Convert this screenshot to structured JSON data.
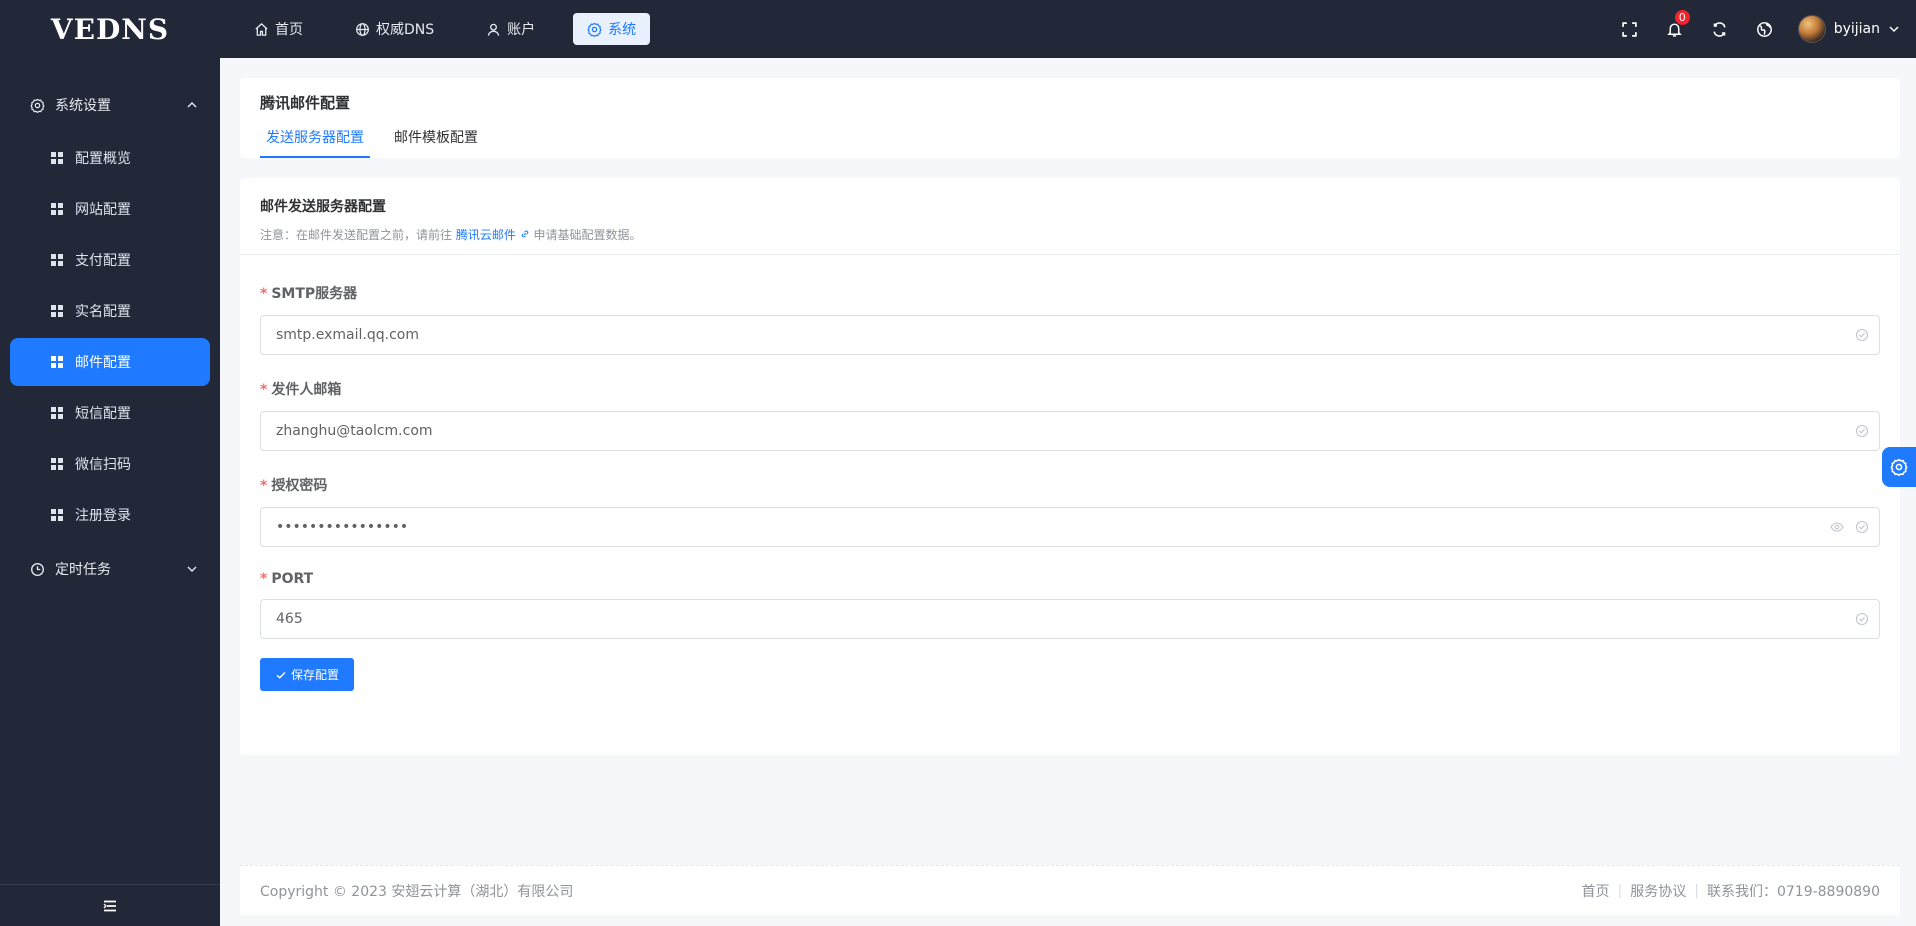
{
  "app": {
    "logo": "VEDNS"
  },
  "topnav": [
    {
      "label": "首页",
      "icon": "home-icon"
    },
    {
      "label": "权威DNS",
      "icon": "globe-icon"
    },
    {
      "label": "账户",
      "icon": "user-icon"
    },
    {
      "label": "系统",
      "icon": "gear-icon",
      "active": true
    }
  ],
  "header": {
    "notification_count": "0",
    "username": "byijian"
  },
  "sidebar": {
    "group1": "系统设置",
    "items": [
      "配置概览",
      "网站配置",
      "支付配置",
      "实名配置",
      "邮件配置",
      "短信配置",
      "微信扫码",
      "注册登录"
    ],
    "active_item": "邮件配置",
    "group2": "定时任务"
  },
  "page": {
    "card_title": "腾讯邮件配置",
    "tabs": [
      "发送服务器配置",
      "邮件模板配置"
    ],
    "section_title": "邮件发送服务器配置",
    "note_prefix": "注意：在邮件发送配置之前，请前往",
    "note_link": "腾讯云邮件",
    "note_suffix": "申请基础配置数据。"
  },
  "form": {
    "smtp_label": "SMTP服务器",
    "smtp_value": "smtp.exmail.qq.com",
    "sender_label": "发件人邮箱",
    "sender_value": "zhanghu@taolcm.com",
    "auth_label": "授权密码",
    "auth_value": "••••••••••••••••",
    "port_label": "PORT",
    "port_value": "465",
    "save_label": "保存配置"
  },
  "footer": {
    "copyright": "Copyright © 2023 安翅云计算（湖北）有限公司",
    "links": [
      "首页",
      "服务协议",
      "联系我们：0719-8890890"
    ]
  },
  "colors": {
    "primary": "#1f7aff",
    "sidebar_bg": "#222838",
    "badge": "#f5222d",
    "required": "#f56c6c"
  }
}
